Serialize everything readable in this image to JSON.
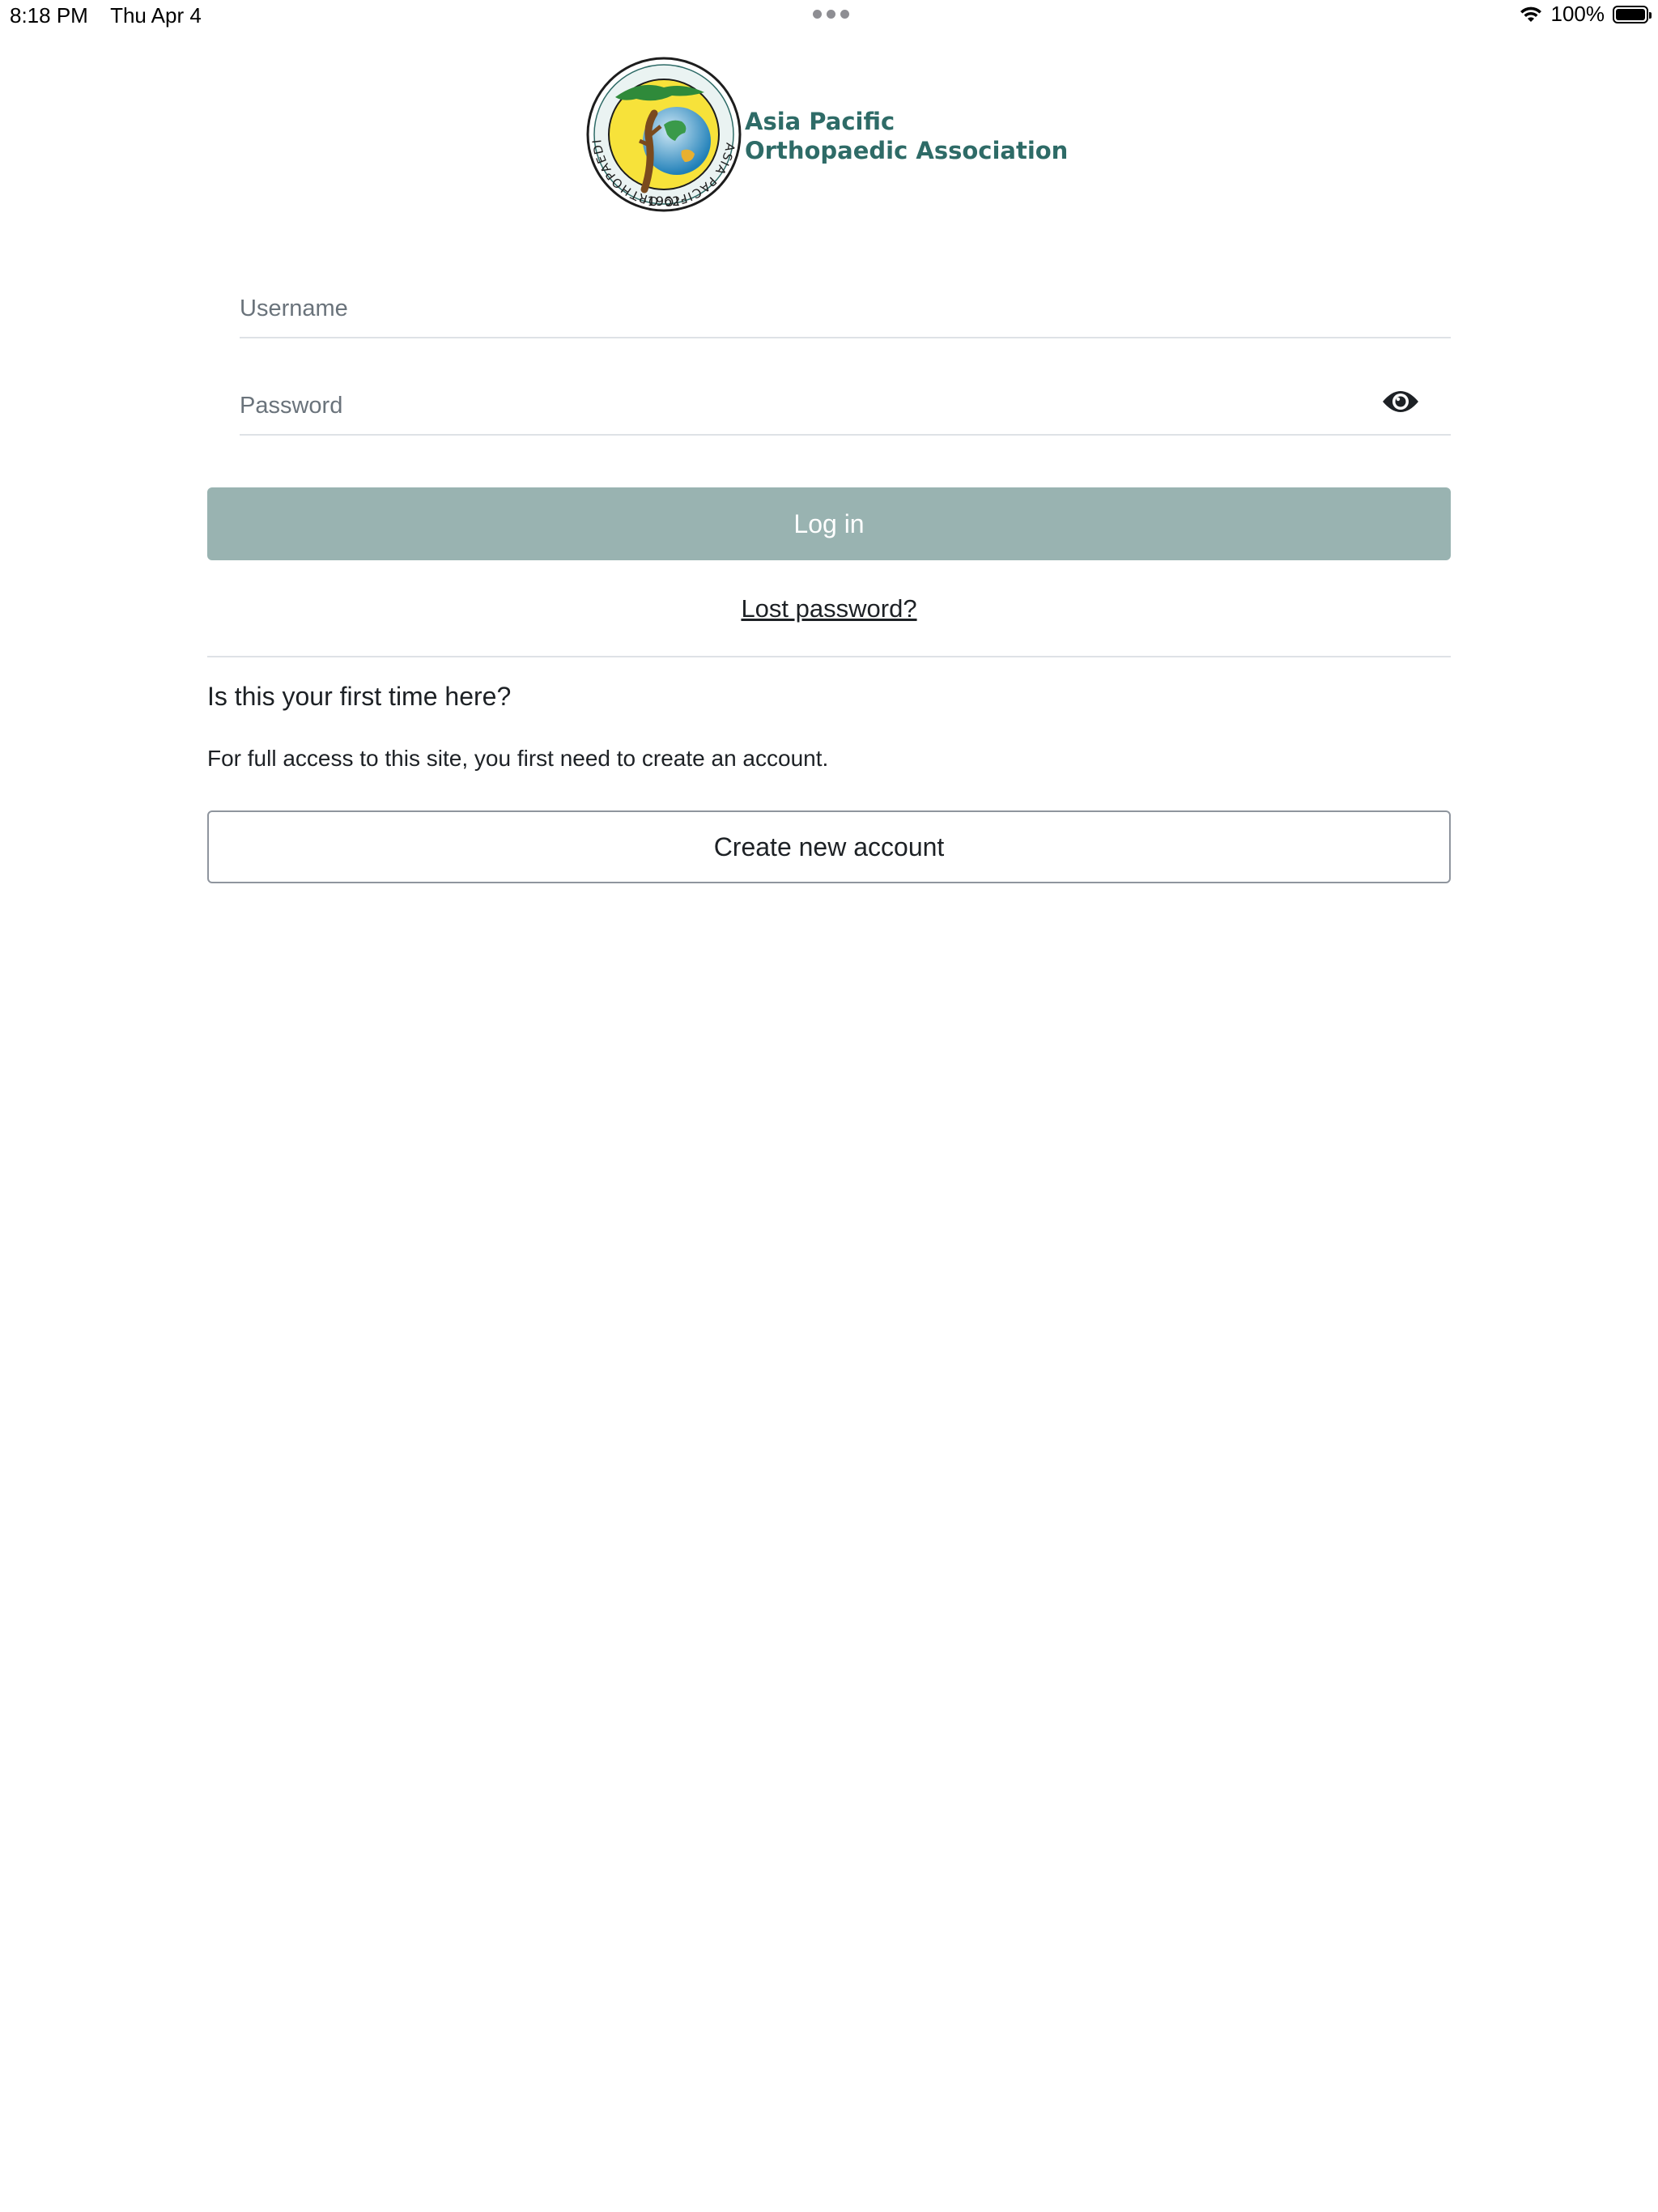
{
  "status_bar": {
    "time": "8:18 PM",
    "date": "Thu Apr 4",
    "battery_percent": "100%",
    "icons": [
      "wifi-icon",
      "battery-icon",
      "multitask-dots-icon"
    ]
  },
  "brand": {
    "name_line1": "Asia Pacific",
    "name_line2": "Orthopaedic Association",
    "seal_text": "ASIA PACIFIC ORTHOPAEDIC ASSOCIATION",
    "seal_year": "·1962·",
    "color": "#2e6b67"
  },
  "login_form": {
    "username_placeholder": "Username",
    "username_value": "",
    "password_placeholder": "Password",
    "password_value": "",
    "show_password_icon": "eye-icon",
    "login_label": "Log in",
    "login_color": "#99b3b1",
    "lost_password_label": "Lost password?"
  },
  "signup": {
    "heading": "Is this your first time here?",
    "description": "For full access to this site, you first need to create an account.",
    "create_account_label": "Create new account"
  }
}
